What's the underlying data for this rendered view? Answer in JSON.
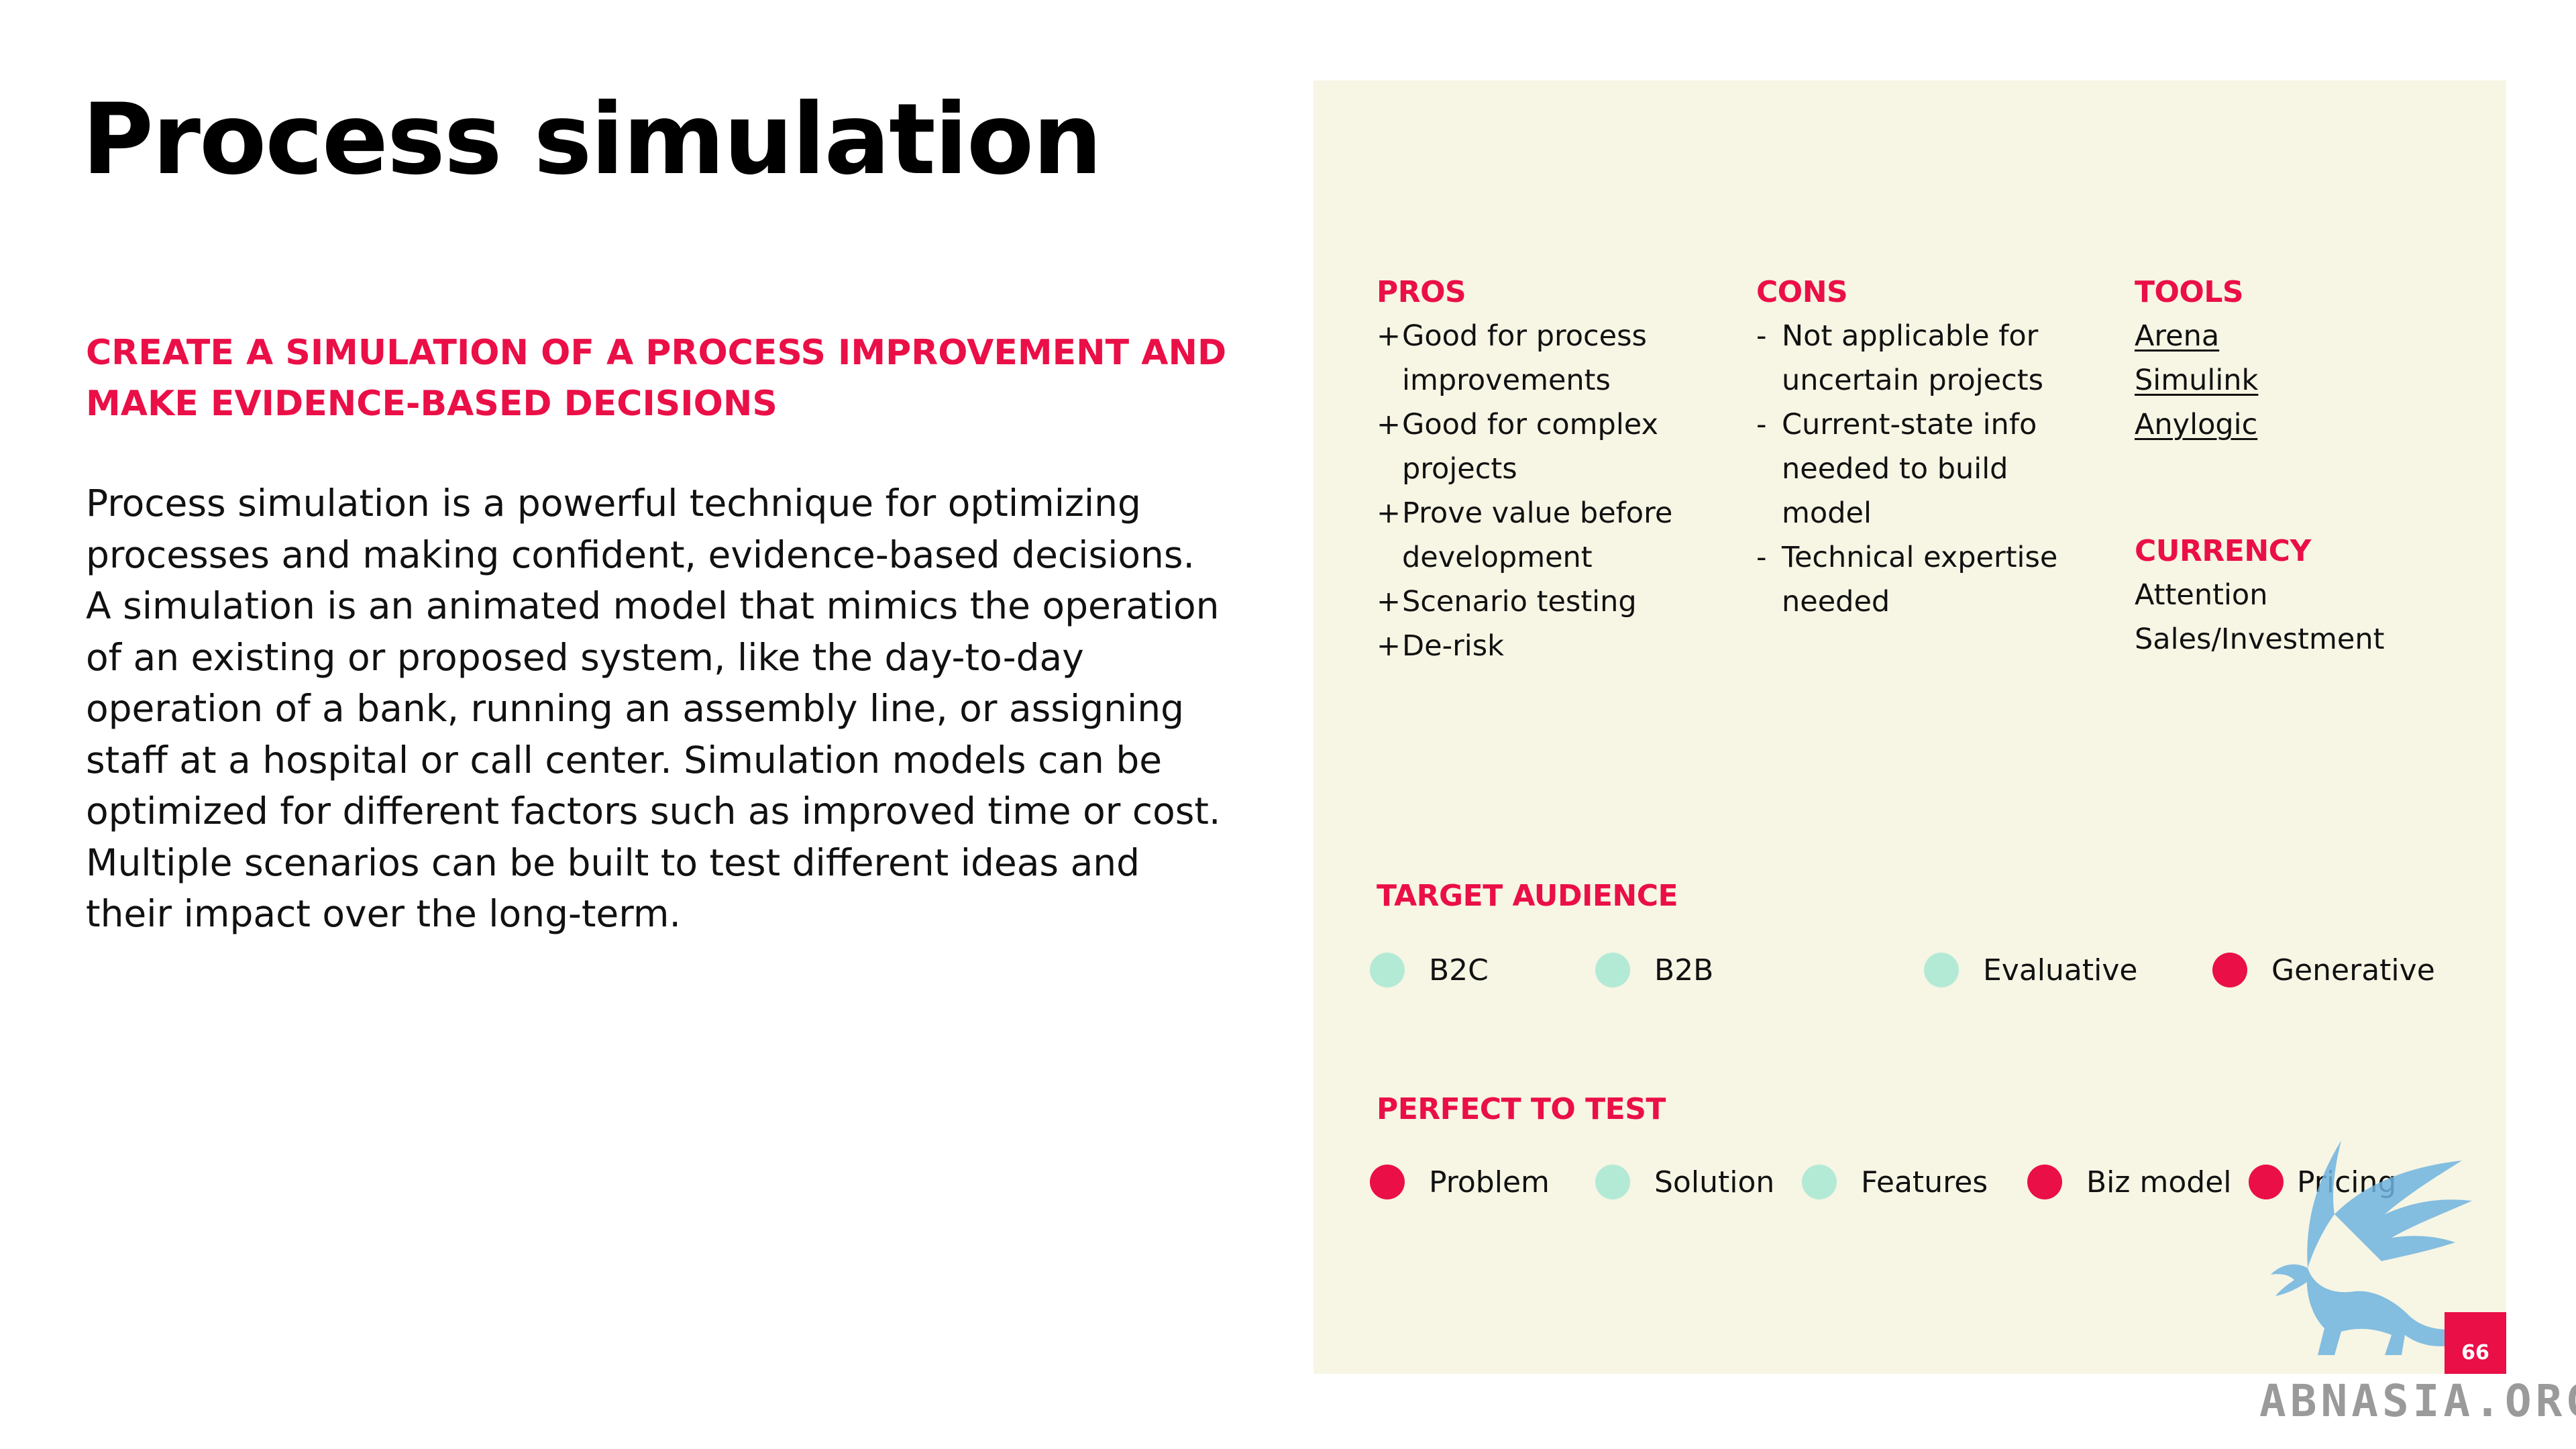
{
  "title": "Process simulation",
  "subtitle": "CREATE A SIMULATION OF A PROCESS IMPROVEMENT AND MAKE EVIDENCE-BASED DECISIONS",
  "description": "Process simulation is a powerful technique for optimizing processes and making confident, evidence-based decisions. A simulation is an animated model that mimics the operation of an existing or proposed system, like the day-to-day operation of a bank, running an assembly line, or assigning staff at a hospital or call center. Simulation models can be optimized for different factors such as improved time or cost. Multiple scenarios can be built to test different ideas and their impact over the long-term.",
  "pros": {
    "label": "PROS",
    "marker": "+",
    "items": [
      "Good for process improvements",
      "Good for complex projects",
      "Prove value before development",
      "Scenario testing",
      "De-risk"
    ]
  },
  "cons": {
    "label": "CONS",
    "marker": "-",
    "items": [
      "Not applicable for uncertain projects",
      "Current-state info needed to build model",
      "Technical expertise needed"
    ]
  },
  "tools": {
    "label": "TOOLS",
    "items": [
      "Arena",
      "Simulink",
      "Anylogic"
    ]
  },
  "currency": {
    "label": "CURRENCY",
    "items": [
      "Attention",
      "Sales/Investment"
    ]
  },
  "target_audience": {
    "label": "TARGET AUDIENCE",
    "items": [
      {
        "label": "B2C",
        "active": false
      },
      {
        "label": "B2B",
        "active": false
      },
      {
        "label": "Evaluative",
        "active": false
      },
      {
        "label": "Generative",
        "active": true
      }
    ]
  },
  "perfect_to_test": {
    "label": "PERFECT TO TEST",
    "items": [
      {
        "label": "Problem",
        "active": true
      },
      {
        "label": "Solution",
        "active": false
      },
      {
        "label": "Features",
        "active": false
      },
      {
        "label": "Biz model",
        "active": true
      },
      {
        "label": "Pricing",
        "active": true
      }
    ]
  },
  "page_number": "66",
  "watermark_text": "ABNASIA.ORG",
  "colors": {
    "accent": "#ea0f47",
    "inactive_dot": "#b3ead6",
    "panel": "#f7f5e4",
    "watermark": "#6fb4e0"
  }
}
